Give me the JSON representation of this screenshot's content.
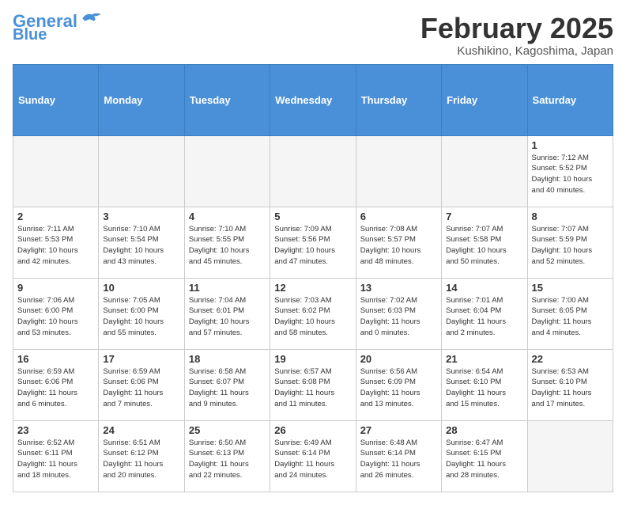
{
  "header": {
    "logo_line1": "General",
    "logo_line2": "Blue",
    "month": "February 2025",
    "location": "Kushikino, Kagoshima, Japan"
  },
  "weekdays": [
    "Sunday",
    "Monday",
    "Tuesday",
    "Wednesday",
    "Thursday",
    "Friday",
    "Saturday"
  ],
  "weeks": [
    [
      {
        "day": "",
        "info": ""
      },
      {
        "day": "",
        "info": ""
      },
      {
        "day": "",
        "info": ""
      },
      {
        "day": "",
        "info": ""
      },
      {
        "day": "",
        "info": ""
      },
      {
        "day": "",
        "info": ""
      },
      {
        "day": "1",
        "info": "Sunrise: 7:12 AM\nSunset: 5:52 PM\nDaylight: 10 hours\nand 40 minutes."
      }
    ],
    [
      {
        "day": "2",
        "info": "Sunrise: 7:11 AM\nSunset: 5:53 PM\nDaylight: 10 hours\nand 42 minutes."
      },
      {
        "day": "3",
        "info": "Sunrise: 7:10 AM\nSunset: 5:54 PM\nDaylight: 10 hours\nand 43 minutes."
      },
      {
        "day": "4",
        "info": "Sunrise: 7:10 AM\nSunset: 5:55 PM\nDaylight: 10 hours\nand 45 minutes."
      },
      {
        "day": "5",
        "info": "Sunrise: 7:09 AM\nSunset: 5:56 PM\nDaylight: 10 hours\nand 47 minutes."
      },
      {
        "day": "6",
        "info": "Sunrise: 7:08 AM\nSunset: 5:57 PM\nDaylight: 10 hours\nand 48 minutes."
      },
      {
        "day": "7",
        "info": "Sunrise: 7:07 AM\nSunset: 5:58 PM\nDaylight: 10 hours\nand 50 minutes."
      },
      {
        "day": "8",
        "info": "Sunrise: 7:07 AM\nSunset: 5:59 PM\nDaylight: 10 hours\nand 52 minutes."
      }
    ],
    [
      {
        "day": "9",
        "info": "Sunrise: 7:06 AM\nSunset: 6:00 PM\nDaylight: 10 hours\nand 53 minutes."
      },
      {
        "day": "10",
        "info": "Sunrise: 7:05 AM\nSunset: 6:00 PM\nDaylight: 10 hours\nand 55 minutes."
      },
      {
        "day": "11",
        "info": "Sunrise: 7:04 AM\nSunset: 6:01 PM\nDaylight: 10 hours\nand 57 minutes."
      },
      {
        "day": "12",
        "info": "Sunrise: 7:03 AM\nSunset: 6:02 PM\nDaylight: 10 hours\nand 58 minutes."
      },
      {
        "day": "13",
        "info": "Sunrise: 7:02 AM\nSunset: 6:03 PM\nDaylight: 11 hours\nand 0 minutes."
      },
      {
        "day": "14",
        "info": "Sunrise: 7:01 AM\nSunset: 6:04 PM\nDaylight: 11 hours\nand 2 minutes."
      },
      {
        "day": "15",
        "info": "Sunrise: 7:00 AM\nSunset: 6:05 PM\nDaylight: 11 hours\nand 4 minutes."
      }
    ],
    [
      {
        "day": "16",
        "info": "Sunrise: 6:59 AM\nSunset: 6:06 PM\nDaylight: 11 hours\nand 6 minutes."
      },
      {
        "day": "17",
        "info": "Sunrise: 6:59 AM\nSunset: 6:06 PM\nDaylight: 11 hours\nand 7 minutes."
      },
      {
        "day": "18",
        "info": "Sunrise: 6:58 AM\nSunset: 6:07 PM\nDaylight: 11 hours\nand 9 minutes."
      },
      {
        "day": "19",
        "info": "Sunrise: 6:57 AM\nSunset: 6:08 PM\nDaylight: 11 hours\nand 11 minutes."
      },
      {
        "day": "20",
        "info": "Sunrise: 6:56 AM\nSunset: 6:09 PM\nDaylight: 11 hours\nand 13 minutes."
      },
      {
        "day": "21",
        "info": "Sunrise: 6:54 AM\nSunset: 6:10 PM\nDaylight: 11 hours\nand 15 minutes."
      },
      {
        "day": "22",
        "info": "Sunrise: 6:53 AM\nSunset: 6:10 PM\nDaylight: 11 hours\nand 17 minutes."
      }
    ],
    [
      {
        "day": "23",
        "info": "Sunrise: 6:52 AM\nSunset: 6:11 PM\nDaylight: 11 hours\nand 18 minutes."
      },
      {
        "day": "24",
        "info": "Sunrise: 6:51 AM\nSunset: 6:12 PM\nDaylight: 11 hours\nand 20 minutes."
      },
      {
        "day": "25",
        "info": "Sunrise: 6:50 AM\nSunset: 6:13 PM\nDaylight: 11 hours\nand 22 minutes."
      },
      {
        "day": "26",
        "info": "Sunrise: 6:49 AM\nSunset: 6:14 PM\nDaylight: 11 hours\nand 24 minutes."
      },
      {
        "day": "27",
        "info": "Sunrise: 6:48 AM\nSunset: 6:14 PM\nDaylight: 11 hours\nand 26 minutes."
      },
      {
        "day": "28",
        "info": "Sunrise: 6:47 AM\nSunset: 6:15 PM\nDaylight: 11 hours\nand 28 minutes."
      },
      {
        "day": "",
        "info": ""
      }
    ]
  ]
}
